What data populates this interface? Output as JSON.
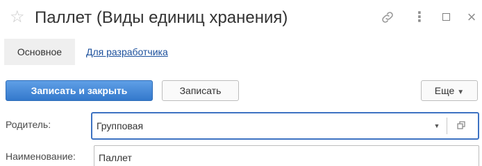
{
  "window": {
    "title": "Паллет (Виды единиц хранения)",
    "star_icon": "star-icon",
    "link_icon": "link-icon",
    "more_icon": "more-vertical-icon",
    "maximize_icon": "maximize-icon",
    "close_icon": "close-icon",
    "more_glyph": "⋮",
    "close_glyph": "×"
  },
  "tabs": [
    {
      "label": "Основное"
    },
    {
      "label": "Для разработчика"
    }
  ],
  "toolbar": {
    "save_close_label": "Записать и закрыть",
    "save_label": "Записать",
    "more_label": "Еще"
  },
  "form": {
    "parent_label": "Родитель:",
    "parent_value": "Групповая",
    "name_label": "Наименование:",
    "name_value": "Паллет"
  },
  "colors": {
    "primary_button": "#3f87d9",
    "link": "#1b4f9c",
    "focus_border": "#3d72c2"
  }
}
